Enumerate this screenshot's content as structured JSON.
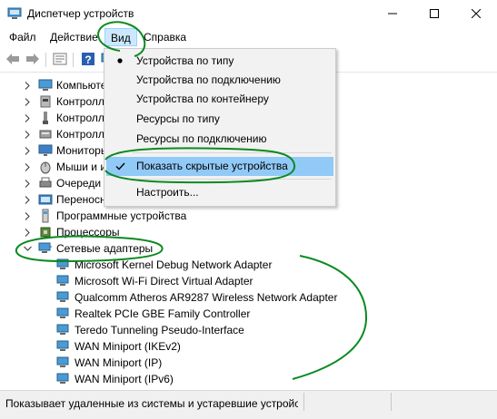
{
  "window": {
    "title": "Диспетчер устройств",
    "icons": {
      "app": "device-manager-icon",
      "minimize": "minimize-icon",
      "maximize": "maximize-icon",
      "close": "close-icon"
    }
  },
  "menubar": {
    "items": [
      {
        "label": "Файл"
      },
      {
        "label": "Действие"
      },
      {
        "label": "Вид",
        "active": true
      },
      {
        "label": "Справка"
      }
    ]
  },
  "toolbar": {
    "buttons": [
      "back-icon",
      "forward-icon",
      "properties-icon",
      "help-icon",
      "monitor-icon"
    ]
  },
  "view_menu": {
    "items": [
      {
        "label": "Устройства по типу",
        "mark": "bullet"
      },
      {
        "label": "Устройства по подключению"
      },
      {
        "label": "Устройства по контейнеру"
      },
      {
        "label": "Ресурсы по типу"
      },
      {
        "label": "Ресурсы по подключению"
      },
      {
        "label": "Показать скрытые устройства",
        "mark": "check",
        "highlighted": true
      },
      {
        "label": "Настроить..."
      }
    ]
  },
  "tree": {
    "categories": [
      {
        "label": "Компьютер",
        "icon": "computer-icon"
      },
      {
        "label": "Контроллеры IDE ATA/ATAPI",
        "icon": "ide-controller-icon"
      },
      {
        "label": "Контроллеры USB",
        "icon": "usb-icon"
      },
      {
        "label": "Контроллеры запоминающих устройств",
        "icon": "storage-controller-icon"
      },
      {
        "label": "Мониторы",
        "icon": "monitor-icon"
      },
      {
        "label": "Мыши и иные указывающие устройства",
        "icon": "mouse-icon"
      },
      {
        "label": "Очереди печати",
        "icon": "print-queue-icon"
      },
      {
        "label": "Переносные устройства",
        "icon": "portable-device-icon"
      },
      {
        "label": "Программные устройства",
        "icon": "software-device-icon"
      },
      {
        "label": "Процессоры",
        "icon": "processor-icon"
      },
      {
        "label": "Сетевые адаптеры",
        "icon": "network-adapter-icon",
        "expanded": true
      }
    ],
    "adapters": [
      "Microsoft Kernel Debug Network Adapter",
      "Microsoft Wi-Fi Direct Virtual Adapter",
      "Qualcomm Atheros AR9287 Wireless Network Adapter",
      "Realtek PCIe GBE Family Controller",
      "Teredo Tunneling Pseudo-Interface",
      "WAN Miniport (IKEv2)",
      "WAN Miniport (IP)",
      "WAN Miniport (IPv6)"
    ]
  },
  "statusbar": {
    "text": "Показывает удаленные из системы и устаревшие устройства"
  },
  "colors": {
    "menu_highlight": "#91c9f7",
    "menubar_active": "#cce8ff",
    "annotation": "#0a8a20"
  }
}
